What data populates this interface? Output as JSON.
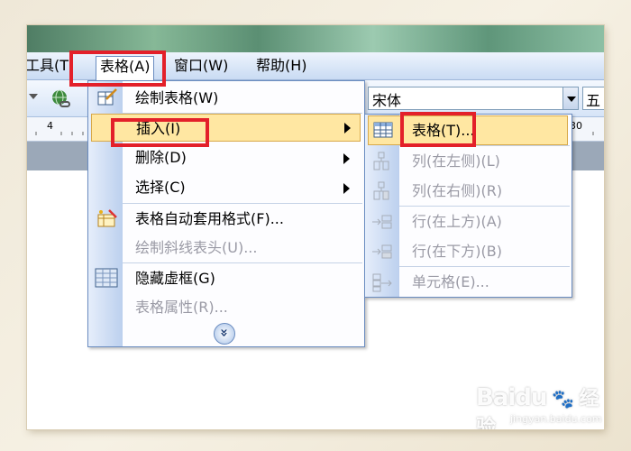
{
  "menubar": {
    "tools": "工具(T)",
    "table": "表格(A)",
    "window": "窗口(W)",
    "help": "帮助(H)"
  },
  "toolbar": {
    "font_name": "宋体",
    "font_size": "五"
  },
  "ruler": {
    "left_mark": "4",
    "right_mark": "30"
  },
  "table_menu": {
    "items": [
      {
        "label": "绘制表格(W)",
        "icon": "draw-table-icon"
      },
      {
        "label": "插入(I)",
        "submenu": true
      },
      {
        "label": "删除(D)",
        "submenu": true
      },
      {
        "label": "选择(C)",
        "submenu": true
      },
      {
        "label": "表格自动套用格式(F)...",
        "icon": "autoformat-icon"
      },
      {
        "label": "绘制斜线表头(U)...",
        "disabled": true
      },
      {
        "label": "隐藏虚框(G)",
        "icon": "gridlines-icon"
      },
      {
        "label": "表格属性(R)...",
        "disabled": true
      }
    ],
    "expand": "»"
  },
  "insert_submenu": {
    "items": [
      {
        "label": "表格(T)...",
        "icon": "table-icon"
      },
      {
        "label": "列(在左侧)(L)",
        "disabled": true,
        "icon": "insert-column-left-icon"
      },
      {
        "label": "列(在右侧)(R)",
        "disabled": true,
        "icon": "insert-column-right-icon"
      },
      {
        "label": "行(在上方)(A)",
        "disabled": true,
        "icon": "insert-row-above-icon"
      },
      {
        "label": "行(在下方)(B)",
        "disabled": true,
        "icon": "insert-row-below-icon"
      },
      {
        "label": "单元格(E)...",
        "disabled": true,
        "icon": "insert-cell-icon"
      }
    ]
  },
  "watermark": {
    "brand": "Baidu",
    "brand_cn": "经验",
    "url": "jingyan.baidu.com"
  },
  "colors": {
    "highlight": "#e3202a",
    "menu_hover": "#ffe7a2",
    "menu_border": "#6a8cc0"
  }
}
